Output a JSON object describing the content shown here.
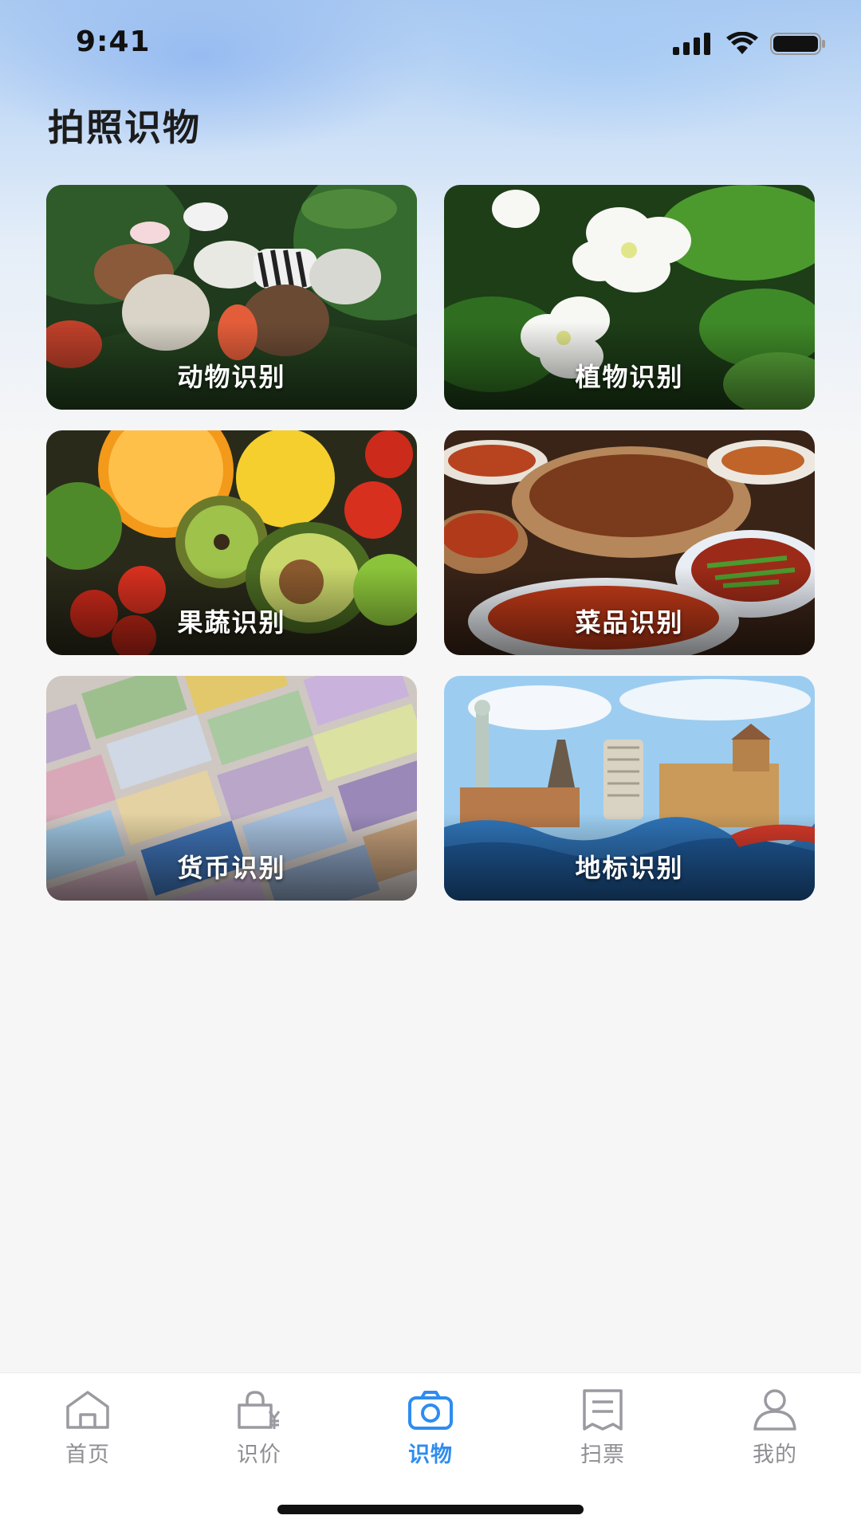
{
  "status_bar": {
    "time": "9:41",
    "signal_icon": "cellular-signal-icon",
    "wifi_icon": "wifi-icon",
    "battery_icon": "battery-icon"
  },
  "header": {
    "title": "拍照识物"
  },
  "categories": [
    {
      "label": "动物识别",
      "image": "animals-image"
    },
    {
      "label": "植物识别",
      "image": "plants-image"
    },
    {
      "label": "果蔬识别",
      "image": "fruits-vegetables-image"
    },
    {
      "label": "菜品识别",
      "image": "dishes-image"
    },
    {
      "label": "货币识别",
      "image": "currency-image"
    },
    {
      "label": "地标识别",
      "image": "landmarks-image"
    }
  ],
  "tabbar": {
    "active_color": "#2f8cf0",
    "inactive_color": "#8e8e93",
    "items": [
      {
        "label": "首页",
        "icon": "home-icon"
      },
      {
        "label": "识价",
        "icon": "price-bag-icon"
      },
      {
        "label": "识物",
        "icon": "camera-icon",
        "active": true
      },
      {
        "label": "扫票",
        "icon": "receipt-icon"
      },
      {
        "label": "我的",
        "icon": "user-icon"
      }
    ]
  }
}
